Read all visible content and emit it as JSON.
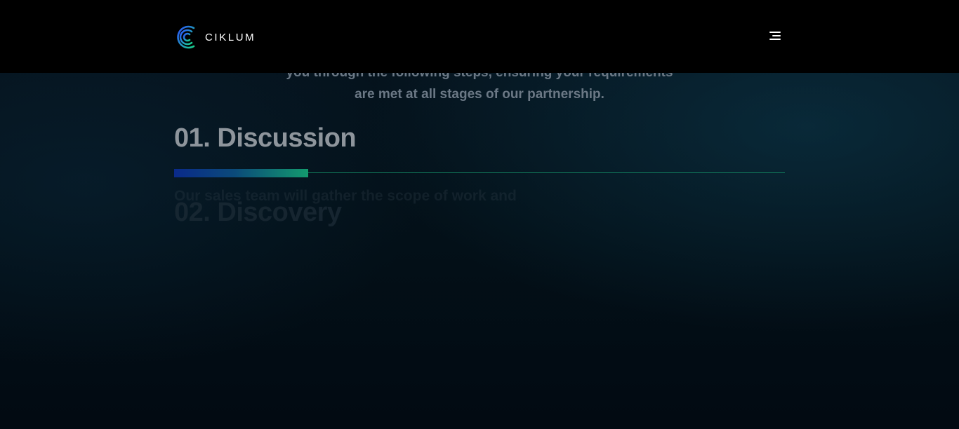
{
  "header": {
    "logo_text": "CIKLUM",
    "logo_icon": "ciklum-logo-icon",
    "menu_icon": "hamburger-menu-icon"
  },
  "intro": {
    "line1": "you through the following steps, ensuring your requirements",
    "line2": "are met at all stages of our partnership."
  },
  "steps": [
    {
      "title": "01. Discussion",
      "description": "Our sales team will gather the scope of work and"
    },
    {
      "title": "02. Discovery"
    }
  ],
  "progress": {
    "fraction": 0.22
  },
  "colors": {
    "background": "#000000",
    "accent_green": "#139a6e",
    "accent_blue": "#0a2a8a",
    "title_gray": "#8e959c"
  }
}
